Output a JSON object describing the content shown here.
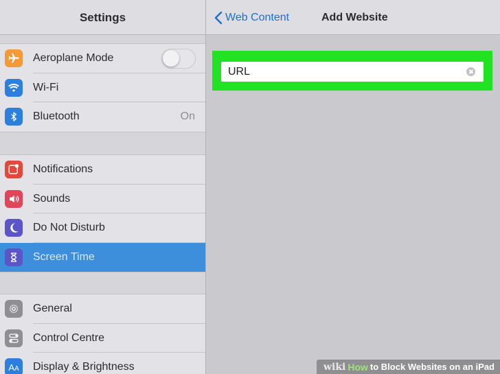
{
  "sidebar": {
    "title": "Settings",
    "groups": [
      {
        "items": [
          {
            "label": "Aeroplane Mode",
            "icon": "airplane-icon",
            "color": "#f29a38",
            "control": "toggle",
            "toggle_on": false
          },
          {
            "label": "Wi-Fi",
            "icon": "wifi-icon",
            "color": "#2c7fdc"
          },
          {
            "label": "Bluetooth",
            "icon": "bluetooth-icon",
            "color": "#2c7fdc",
            "value": "On"
          }
        ]
      },
      {
        "items": [
          {
            "label": "Notifications",
            "icon": "notifications-icon",
            "color": "#e2483c"
          },
          {
            "label": "Sounds",
            "icon": "speaker-icon",
            "color": "#e2455a"
          },
          {
            "label": "Do Not Disturb",
            "icon": "moon-icon",
            "color": "#5b55c9"
          },
          {
            "label": "Screen Time",
            "icon": "hourglass-icon",
            "color": "#5b55c9",
            "selected": true
          }
        ]
      },
      {
        "items": [
          {
            "label": "General",
            "icon": "gear-icon",
            "color": "#8e8e93"
          },
          {
            "label": "Control Centre",
            "icon": "switches-icon",
            "color": "#8e8e93"
          },
          {
            "label": "Display & Brightness",
            "icon": "text-size-icon",
            "color": "#2c7fdc"
          }
        ]
      }
    ]
  },
  "main": {
    "back_label": "Web Content",
    "title": "Add Website",
    "url_placeholder": "URL",
    "highlight_color": "#22e224"
  },
  "watermark": {
    "wiki": "wiki",
    "how": "How",
    "rest": "to Block Websites on an iPad"
  }
}
